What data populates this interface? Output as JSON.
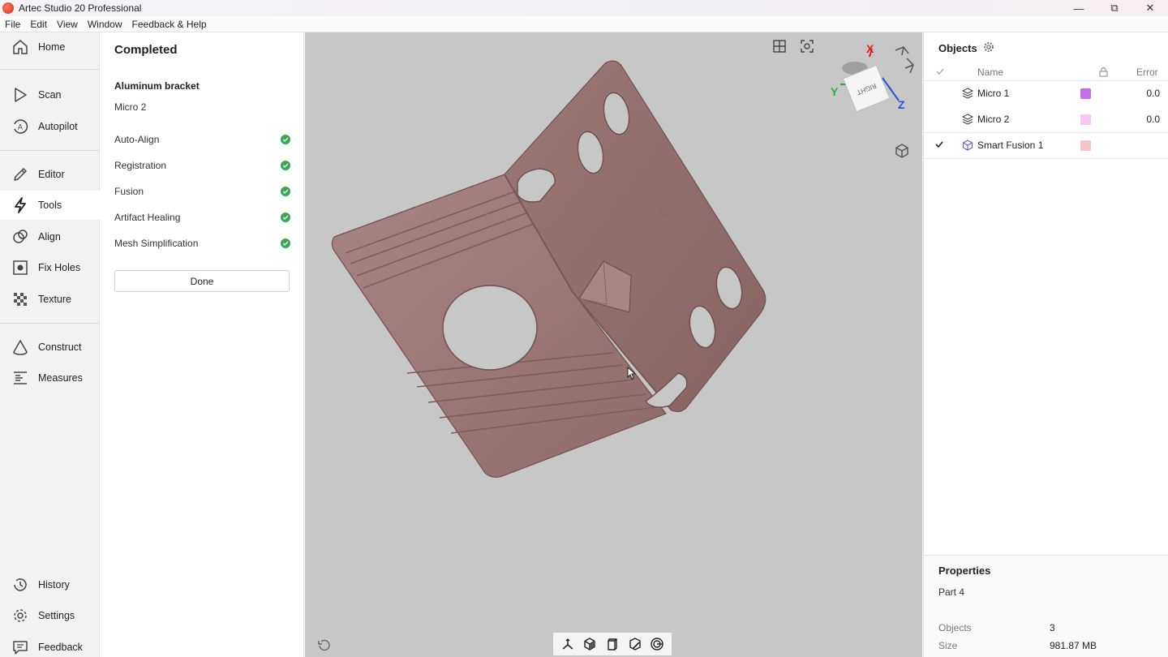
{
  "window": {
    "title": "Artec Studio 20 Professional",
    "controls": {
      "minimize": "—",
      "restore": "⧉",
      "close": "✕"
    }
  },
  "menu": [
    "File",
    "Edit",
    "View",
    "Window",
    "Feedback & Help"
  ],
  "nav": {
    "items": [
      {
        "label": "Home",
        "icon": "home-icon"
      },
      {
        "label": "Scan",
        "icon": "scan-play-icon"
      },
      {
        "label": "Autopilot",
        "icon": "autopilot-icon"
      },
      {
        "label": "Editor",
        "icon": "pencil-icon"
      },
      {
        "label": "Tools",
        "icon": "lightning-icon",
        "active": true
      },
      {
        "label": "Align",
        "icon": "align-icon"
      },
      {
        "label": "Fix Holes",
        "icon": "fix-holes-icon"
      },
      {
        "label": "Texture",
        "icon": "texture-icon"
      },
      {
        "label": "Construct",
        "icon": "cone-icon"
      },
      {
        "label": "Measures",
        "icon": "ruler-icon"
      },
      {
        "label": "History",
        "icon": "history-icon"
      },
      {
        "label": "Settings",
        "icon": "gear-icon"
      },
      {
        "label": "Feedback",
        "icon": "feedback-icon"
      }
    ]
  },
  "task": {
    "title": "Completed",
    "project": "Aluminum bracket",
    "scan": "Micro 2",
    "steps": [
      {
        "label": "Auto-Align",
        "status": "done"
      },
      {
        "label": "Registration",
        "status": "done"
      },
      {
        "label": "Fusion",
        "status": "done"
      },
      {
        "label": "Artifact Healing",
        "status": "done"
      },
      {
        "label": "Mesh Simplification",
        "status": "done"
      }
    ],
    "done_label": "Done",
    "status_color": "#3aa64d"
  },
  "viewport": {
    "mesh_color": "#9c7877",
    "background": "#c7c7c7",
    "cube_face_label": "RIGHT",
    "axes": {
      "x": "X",
      "y": "Y",
      "z": "Z"
    },
    "axis_colors": {
      "x": "#e02020",
      "y": "#22b04a",
      "z": "#2a4fd6"
    }
  },
  "objects": {
    "title": "Objects",
    "columns": {
      "name": "Name",
      "error": "Error"
    },
    "rows": [
      {
        "name": "Micro 1",
        "color": "#c46ee8",
        "error": "0.0",
        "checked": false,
        "icon": "scan-layers-icon"
      },
      {
        "name": "Micro 2",
        "color": "#f5c6f2",
        "error": "0.0",
        "checked": false,
        "icon": "scan-layers-icon"
      },
      {
        "name": "Smart Fusion 1",
        "color": "#f7c5c8",
        "error": "",
        "checked": true,
        "icon": "mesh-cube-icon"
      }
    ]
  },
  "properties": {
    "title": "Properties",
    "part": "Part 4",
    "objects_label": "Objects",
    "objects_value": "3",
    "size_label": "Size",
    "size_value": "981.87 MB"
  }
}
